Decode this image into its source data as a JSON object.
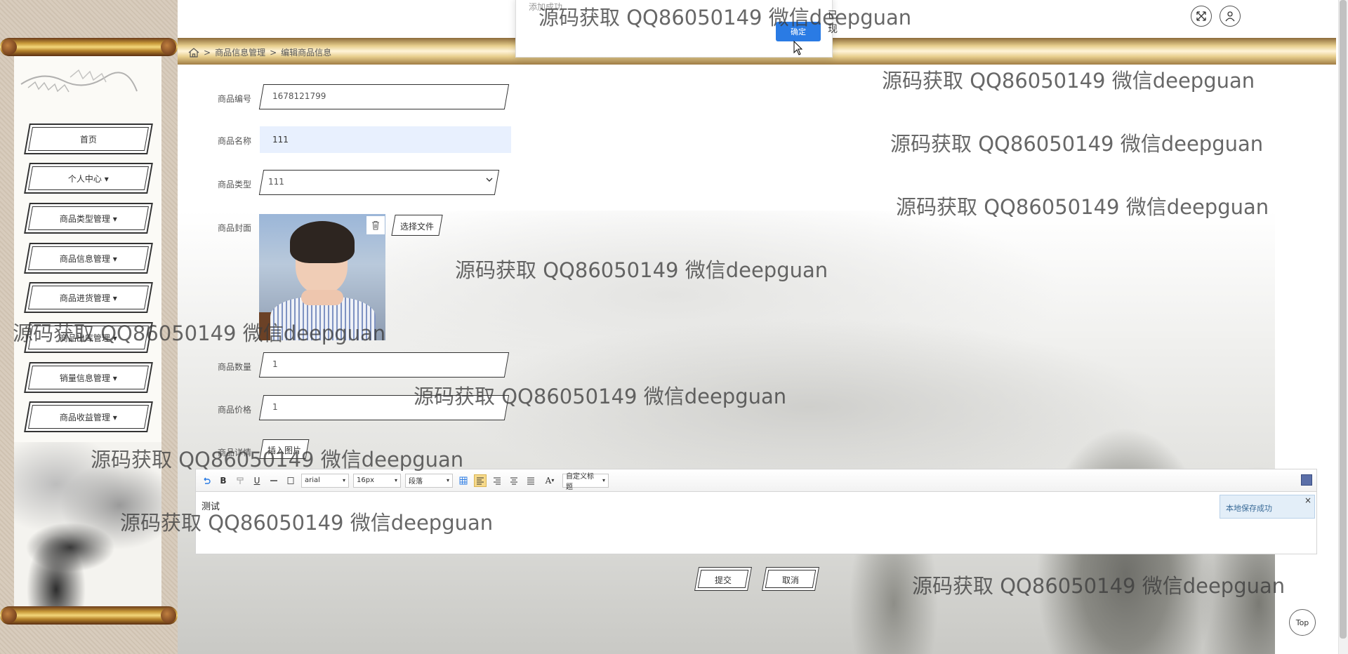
{
  "toast": {
    "title": "添加成功",
    "ok_label": "确定",
    "extra": "已现"
  },
  "breadcrumb": {
    "sep": ">",
    "items": [
      "商品信息管理",
      "编辑商品信息"
    ]
  },
  "sidebar": {
    "items": [
      {
        "label": "首页"
      },
      {
        "label": "个人中心 ▾"
      },
      {
        "label": "商品类型管理 ▾"
      },
      {
        "label": "商品信息管理 ▾"
      },
      {
        "label": "商品进货管理 ▾"
      },
      {
        "label": "商品出库管理 ▾"
      },
      {
        "label": "销量信息管理 ▾"
      },
      {
        "label": "商品收益管理 ▾"
      }
    ]
  },
  "form": {
    "code_label": "商品编号",
    "code_value": "1678121799",
    "name_label": "商品名称",
    "name_value": "111",
    "type_label": "商品类型",
    "type_value": "111",
    "cover_label": "商品封面",
    "choose_file": "选择文件",
    "qty_label": "商品数量",
    "qty_value": "1",
    "price_label": "商品价格",
    "price_value": "1",
    "detail_label": "商品详情",
    "insert_image": "插入图片"
  },
  "editor": {
    "font": "arial",
    "size": "16px",
    "paragraph": "段落",
    "custom_title": "自定义标题",
    "content": "测试",
    "save_tip": "本地保存成功",
    "close": "×",
    "bold": "B",
    "underline": "U",
    "font_color": "A"
  },
  "actions": {
    "submit": "提交",
    "cancel": "取消"
  },
  "top_label": "Top",
  "watermark": "源码获取 QQ86050149 微信deepguan",
  "colors": {
    "accent": "#2a7be4",
    "gold": "#e8cf8e",
    "input_fill": "#e8f0fe"
  }
}
